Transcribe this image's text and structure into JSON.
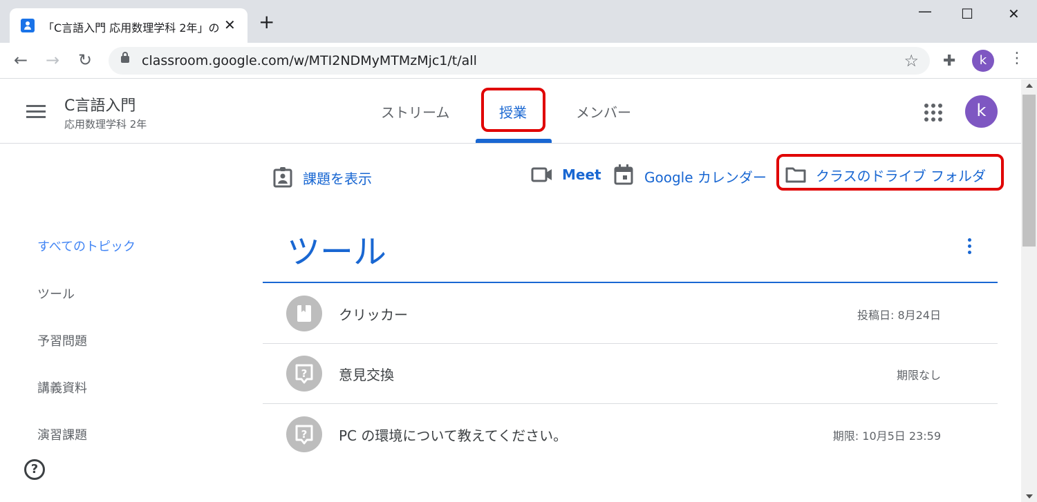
{
  "browser": {
    "tab_title": "「C言語入門 応用数理学科 2年」の",
    "tab_close": "✕",
    "new_tab": "+",
    "win_min": "—",
    "win_max": "☐",
    "win_close": "✕",
    "url": "classroom.google.com/w/MTI2NDMyMTMzMjc1/t/all",
    "profile_initial": "k"
  },
  "header": {
    "class_name": "C言語入門",
    "class_subtitle": "応用数理学科 2年",
    "tabs": [
      {
        "label": "ストリーム"
      },
      {
        "label": "授業"
      },
      {
        "label": "メンバー"
      }
    ],
    "active_tab": "授業",
    "avatar_initial": "k"
  },
  "actions": {
    "view_assignments": "課題を表示",
    "meet": "Meet",
    "calendar": "Google カレンダー",
    "drive_folder": "クラスのドライブ フォルダ"
  },
  "sidebar": {
    "items": [
      {
        "label": "すべてのトピック"
      },
      {
        "label": "ツール"
      },
      {
        "label": "予習問題"
      },
      {
        "label": "講義資料"
      },
      {
        "label": "演習課題"
      }
    ],
    "help": "?"
  },
  "topic": {
    "title": "ツール",
    "items": [
      {
        "title": "クリッカー",
        "meta": "投稿日: 8月24日",
        "icon": "material-icon"
      },
      {
        "title": "意見交換",
        "meta": "期限なし",
        "icon": "question-icon"
      },
      {
        "title": "PC の環境について教えてください。",
        "meta": "期限: 10月5日 23:59",
        "icon": "question-icon"
      }
    ]
  },
  "colors": {
    "accent_blue": "#1967d2",
    "highlight_red": "#e00000",
    "avatar_purple": "#7e57c2"
  }
}
